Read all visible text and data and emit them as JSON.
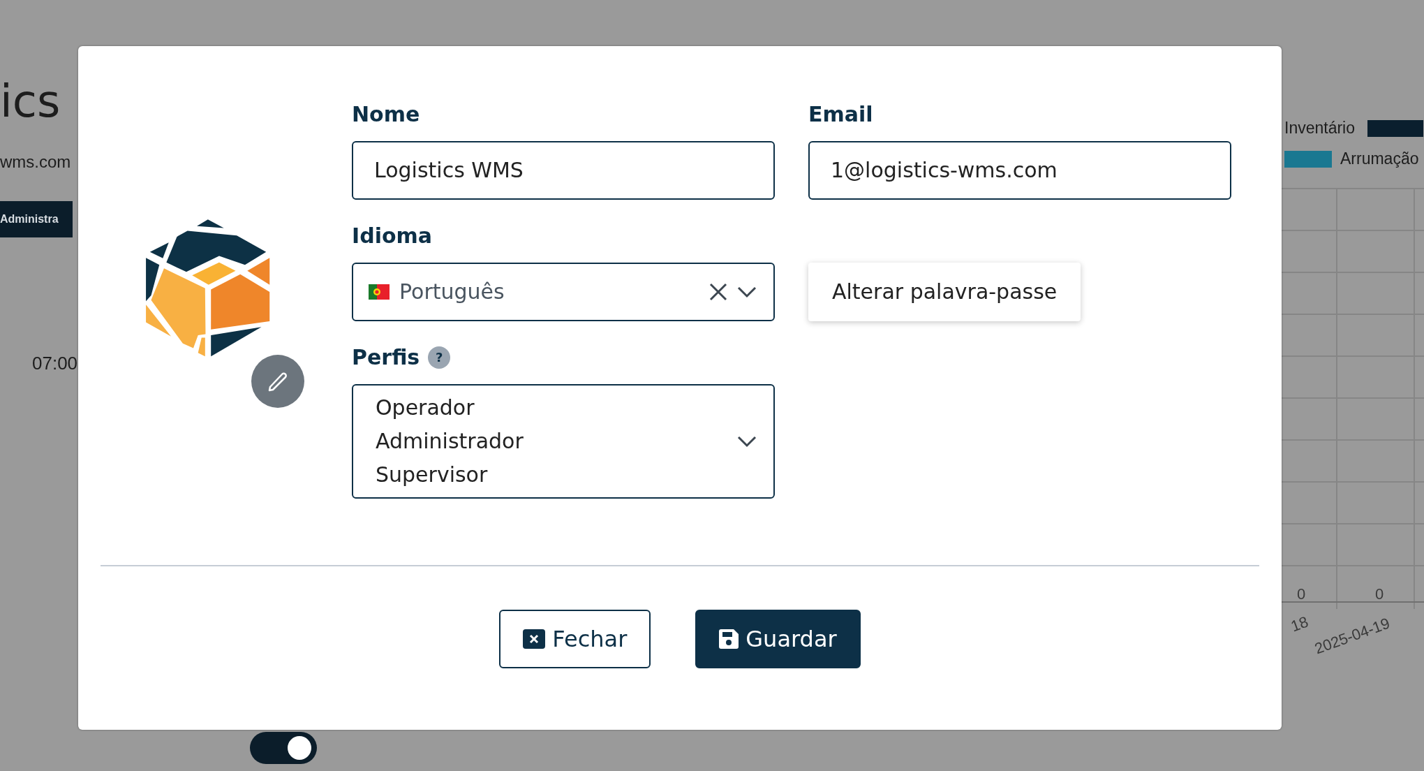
{
  "background": {
    "title": "ics",
    "subtitle": "wms.com",
    "badge": "Administra",
    "time": "07:00",
    "legend": [
      {
        "label": "Inventário",
        "color": "#0a1f2e"
      },
      {
        "label": "Arrumação",
        "color": "#1a7891"
      }
    ],
    "axis_values": [
      "0",
      "0"
    ],
    "dates": [
      "18",
      "2025-04-19"
    ],
    "toggle": {
      "on": true
    }
  },
  "modal": {
    "fields": [
      {
        "label": "Nome",
        "value": "Logistics WMS"
      },
      {
        "label": "Email",
        "value": "1@logistics-wms.com"
      }
    ],
    "language": {
      "label": "Idioma",
      "value": "Português"
    },
    "change_password": "Alterar palavra-passe",
    "profiles": {
      "label": "Perfis",
      "help": "?",
      "values": [
        "Operador",
        "Administrador",
        "Supervisor"
      ]
    },
    "buttons": [
      {
        "label": "Fechar",
        "kind": "close"
      },
      {
        "label": "Guardar",
        "kind": "save"
      }
    ]
  }
}
